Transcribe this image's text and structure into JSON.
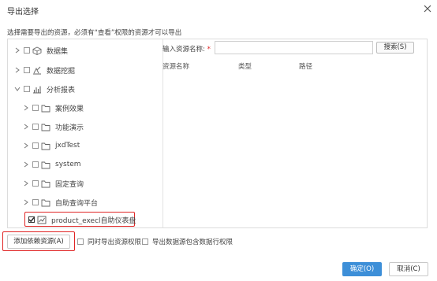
{
  "dialog": {
    "title": "导出选择",
    "instruction": "选择需要导出的资源，必须有“查看”权限的资源才可以导出"
  },
  "tree": {
    "items": [
      {
        "label": "数据集",
        "icon": "cube-icon",
        "checked": false,
        "expanded": false
      },
      {
        "label": "数据挖掘",
        "icon": "mining-icon",
        "checked": false,
        "expanded": false
      },
      {
        "label": "分析报表",
        "icon": "bar-chart-icon",
        "checked": false,
        "expanded": true
      },
      {
        "label": "案例效果",
        "icon": "folder-icon",
        "checked": false,
        "expanded": false
      },
      {
        "label": "功能演示",
        "icon": "folder-icon",
        "checked": false,
        "expanded": false
      },
      {
        "label": "jxdTest",
        "icon": "folder-icon",
        "checked": false,
        "expanded": false
      },
      {
        "label": "system",
        "icon": "folder-icon",
        "checked": false,
        "expanded": false
      },
      {
        "label": "固定查询",
        "icon": "folder-icon",
        "checked": false,
        "expanded": false
      },
      {
        "label": "自助查询平台",
        "icon": "folder-icon",
        "checked": false,
        "expanded": false
      },
      {
        "label": "product_execl自助仪表盘",
        "icon": "dashboard-icon",
        "checked": true,
        "expanded": false
      }
    ]
  },
  "search": {
    "label": "输入资源名称:",
    "required_mark": "*",
    "value": "",
    "placeholder": "",
    "button_label": "搜索(S)"
  },
  "results": {
    "columns": [
      "资源名称",
      "类型",
      "路径"
    ]
  },
  "footer": {
    "add_dependency_label": "添加依赖资源(A)",
    "option_export_permissions": "同时导出资源权限",
    "option_export_row_permissions": "导出数据源包含数据行权限",
    "ok_label": "确定(O)",
    "cancel_label": "取消(C)"
  },
  "colors": {
    "accent": "#3d8fd8",
    "highlight": "#e02424"
  }
}
